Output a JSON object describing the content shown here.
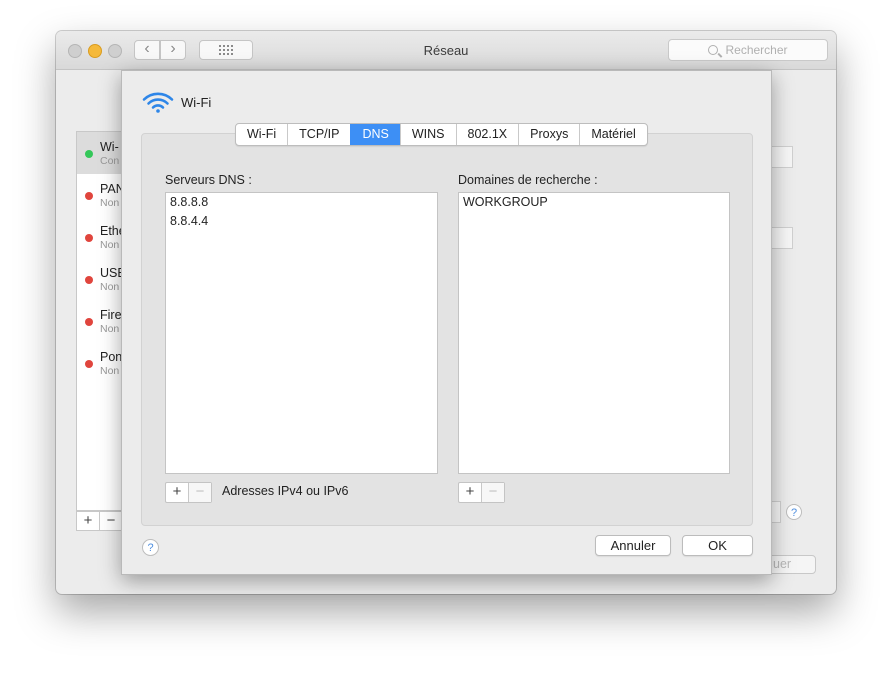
{
  "window": {
    "title": "Réseau",
    "search_placeholder": "Rechercher",
    "nav_back": "‹",
    "nav_forward": "›",
    "fragment_button": "uer"
  },
  "services": [
    {
      "name": "Wi-",
      "status": "Con",
      "status_color": "#34c759",
      "selected": true
    },
    {
      "name": "PAN",
      "status": "Non",
      "status_color": "#e0453d"
    },
    {
      "name": "Ethe",
      "status": "Non",
      "status_color": "#e0453d"
    },
    {
      "name": "USB",
      "status": "Non",
      "status_color": "#e0453d"
    },
    {
      "name": "Fire",
      "status": "Non",
      "status_color": "#e0453d"
    },
    {
      "name": "Pon",
      "status": "Non",
      "status_color": "#e0453d"
    }
  ],
  "sheet": {
    "connection": "Wi-Fi",
    "tabs": [
      {
        "label": "Wi-Fi"
      },
      {
        "label": "TCP/IP"
      },
      {
        "label": "DNS",
        "active": true
      },
      {
        "label": "WINS"
      },
      {
        "label": "802.1X"
      },
      {
        "label": "Proxys"
      },
      {
        "label": "Matériel"
      }
    ],
    "dns_label": "Serveurs DNS :",
    "dns_servers": [
      "8.8.8.8",
      "8.8.4.4"
    ],
    "domains_label": "Domaines de recherche :",
    "search_domains": [
      "WORKGROUP"
    ],
    "plus": "+",
    "minus": "−",
    "hint": "Adresses IPv4 ou IPv6",
    "help": "?",
    "cancel": "Annuler",
    "ok": "OK"
  },
  "colors": {
    "accent": "#3d8ff5",
    "wifi": "#2e86e8"
  }
}
